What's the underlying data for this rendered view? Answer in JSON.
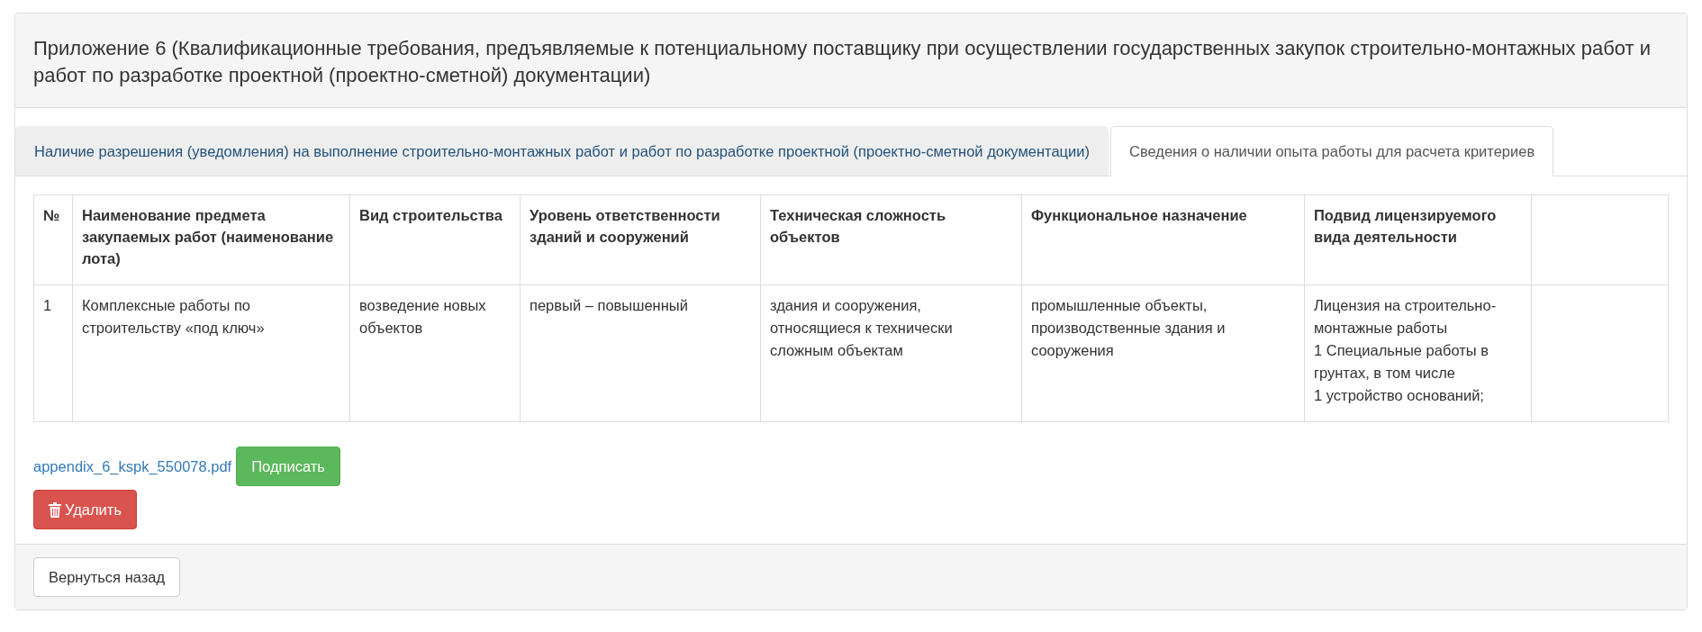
{
  "panel": {
    "title": "Приложение 6 (Квалификационные требования, предъявляемые к потенциальному поставщику при осуществлении государственных закупок строительно-монтажных работ и работ по разработке проектной (проектно-сметной) документации)"
  },
  "tabs": [
    {
      "label": "Наличие разрешения (уведомления) на выполнение строительно-монтажных работ и работ по разработке проектной (проектно-сметной документации)",
      "selected": false
    },
    {
      "label": "Сведения о наличии опыта работы для расчета критериев",
      "selected": true
    }
  ],
  "table": {
    "columns": [
      "№",
      "Наименование предмета закупаемых работ (наименование лота)",
      "Вид строительства",
      "Уровень ответственности зданий и сооружений",
      "Техническая сложность объектов",
      "Функциональное назначение",
      "Подвид лицензируемого вида деятельности"
    ],
    "rows": [
      {
        "cells": [
          "1",
          "Комплексные работы по строительству «под ключ»",
          "возведение новых объектов",
          "первый – повышенный",
          "здания и сооружения, относящиеся к технически сложным объектам",
          "промышленные объекты, производственные здания и сооружения",
          "Лицензия на строительно-монтажные работы\n1 Специальные работы в грунтах, в том числе\n1 устройство оснований;"
        ]
      }
    ]
  },
  "file_link": "appendix_6_kspk_550078.pdf",
  "sign_button": "Подписать",
  "delete_button": "Удалить",
  "footer": {
    "back_button": "Вернуться назад"
  }
}
